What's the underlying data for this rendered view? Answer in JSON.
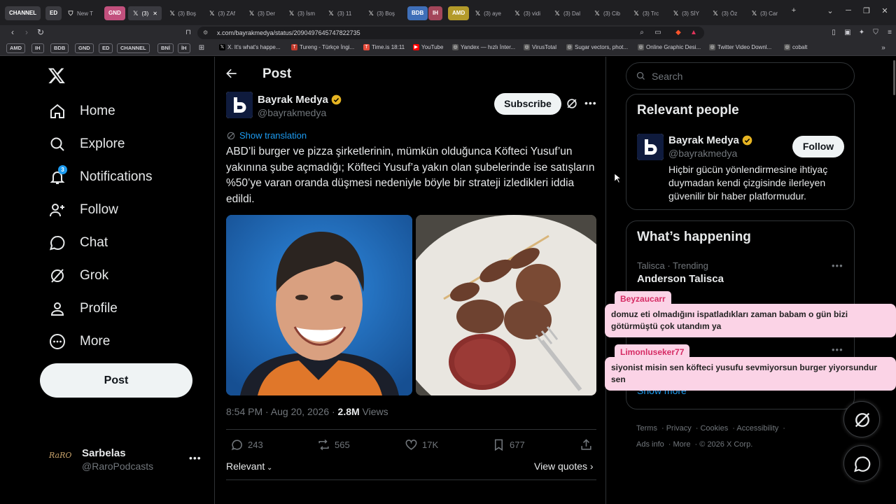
{
  "browser": {
    "pinned_groups": [
      {
        "label": "CHANNEL",
        "color": "#3b3b40"
      },
      {
        "label": "ED",
        "color": "#3b3b40"
      }
    ],
    "tabs": [
      {
        "label": "New T",
        "icon": "shield-icon"
      },
      {
        "label": "GND",
        "group": true,
        "color": "#c2507d"
      },
      {
        "label": "(3)",
        "icon": "x-icon",
        "active": true
      },
      {
        "label": "(3) Boş",
        "icon": "x-icon"
      },
      {
        "label": "(3) ZAf",
        "icon": "x-icon"
      },
      {
        "label": "(3) Der",
        "icon": "x-icon"
      },
      {
        "label": "(3) İsm",
        "icon": "x-icon"
      },
      {
        "label": "(3) 11",
        "icon": "x-icon"
      },
      {
        "label": "(3) Boş",
        "icon": "x-icon"
      },
      {
        "label": "BDB",
        "group": true,
        "color": "#3f6fb8"
      },
      {
        "label": "IH",
        "group": true,
        "color": "#a3465a"
      },
      {
        "label": "AMD",
        "group": true,
        "color": "#b39a2a"
      },
      {
        "label": "(3) aye",
        "icon": "x-icon"
      },
      {
        "label": "(3) vidi",
        "icon": "x-icon"
      },
      {
        "label": "(3) Dal",
        "icon": "x-icon"
      },
      {
        "label": "(3) Cib",
        "icon": "x-icon"
      },
      {
        "label": "(3) Trc",
        "icon": "x-icon"
      },
      {
        "label": "(3) SİY",
        "icon": "x-icon"
      },
      {
        "label": "(3) Öz",
        "icon": "x-icon"
      },
      {
        "label": "(3) Car",
        "icon": "x-icon"
      }
    ],
    "url": "x.com/bayrakmedya/status/2090497645747822735",
    "bookmark_chips": [
      "AMD",
      "IH",
      "BDB",
      "GND",
      "ED",
      "CHANNEL",
      "BNİ",
      "İH"
    ],
    "bookmarks": [
      {
        "label": "X. It's what's happe...",
        "icon": "x-icon",
        "color": "#000000"
      },
      {
        "label": "Tureng - Türkçe İngi...",
        "icon": "tureng-icon",
        "color": "#c0392b"
      },
      {
        "label": "Time.is 18:11",
        "icon": "time-icon",
        "color": "#e74c3c"
      },
      {
        "label": "YouTube",
        "icon": "youtube-icon",
        "color": "#ff0000"
      },
      {
        "label": "Yandex — hızlı İnter...",
        "icon": "globe-icon",
        "color": "#555555"
      },
      {
        "label": "VirusTotal",
        "icon": "globe-icon",
        "color": "#555555"
      },
      {
        "label": "Sugar vectors, phot...",
        "icon": "globe-icon",
        "color": "#555555"
      },
      {
        "label": "Online Graphic Desi...",
        "icon": "globe-icon",
        "color": "#555555"
      },
      {
        "label": "Twitter Video Downl...",
        "icon": "globe-icon",
        "color": "#555555"
      },
      {
        "label": "cobalt",
        "icon": "globe-icon",
        "color": "#555555"
      }
    ]
  },
  "nav": {
    "items": [
      {
        "label": "Home",
        "icon": "home-icon"
      },
      {
        "label": "Explore",
        "icon": "search-icon"
      },
      {
        "label": "Notifications",
        "icon": "bell-icon",
        "badge": "3"
      },
      {
        "label": "Follow",
        "icon": "add-person-icon"
      },
      {
        "label": "Chat",
        "icon": "chat-bubble-icon"
      },
      {
        "label": "Grok",
        "icon": "grok-icon"
      },
      {
        "label": "Profile",
        "icon": "person-icon"
      },
      {
        "label": "More",
        "icon": "more-circle-icon"
      }
    ],
    "post_button": "Post",
    "account": {
      "name": "Sarbelas",
      "handle": "@RaroPodcasts",
      "avatar_text": "RaRO"
    }
  },
  "post": {
    "header_title": "Post",
    "author_name": "Bayrak Medya",
    "author_handle": "@bayrakmedya",
    "subscribe_label": "Subscribe",
    "show_translation": "Show translation",
    "text": "ABD’li burger ve pizza şirketlerinin, mümkün olduğunca Köfteci Yusuf’un yakınına şube açmadığı; Köfteci Yusuf’a yakın olan şubelerinde ise satışların %50’ye varan oranda düşmesi nedeniyle böyle bir strateji izledikleri iddia edildi.",
    "time": "8:54 PM · Aug 20, 2026 · ",
    "views_count": "2.8M",
    "views_label": " Views",
    "replies": "243",
    "reposts": "565",
    "likes": "17K",
    "bookmarks": "677",
    "sort_label": "Relevant",
    "view_quotes": "View quotes"
  },
  "sidebar": {
    "search_placeholder": "Search",
    "relevant_title": "Relevant people",
    "person": {
      "name": "Bayrak Medya",
      "handle": "@bayrakmedya",
      "follow_label": "Follow",
      "bio": "Hiçbir gücün yönlendirmesine ihtiyaç duymadan kendi çizgisinde ilerleyen güvenilir bir haber platformudur."
    },
    "happening_title": "What’s happening",
    "trends": [
      {
        "context": "Talisca · Trending",
        "title": "Anderson Talisca"
      }
    ],
    "show_more": "Show more",
    "footer": [
      "Terms",
      "Privacy",
      "Cookies",
      "Accessibility",
      "Ads info",
      "More",
      "© 2026 X Corp."
    ]
  },
  "overlay_comments": [
    {
      "user": "Beyzaucarr",
      "text": "domuz eti olmadığını ispatladıkları zaman babam o gün bizi götürmüştü çok utandım ya"
    },
    {
      "user": "Limonluseker77",
      "text": "siyonist misin sen köfteci yusufu sevmiyorsun burger yiyorsundur sen"
    }
  ],
  "colors": {
    "accent": "#1d9bf0",
    "verified_gold": "#e6b422",
    "comment_bg": "#fbd3e6",
    "comment_name": "#d62b64"
  }
}
